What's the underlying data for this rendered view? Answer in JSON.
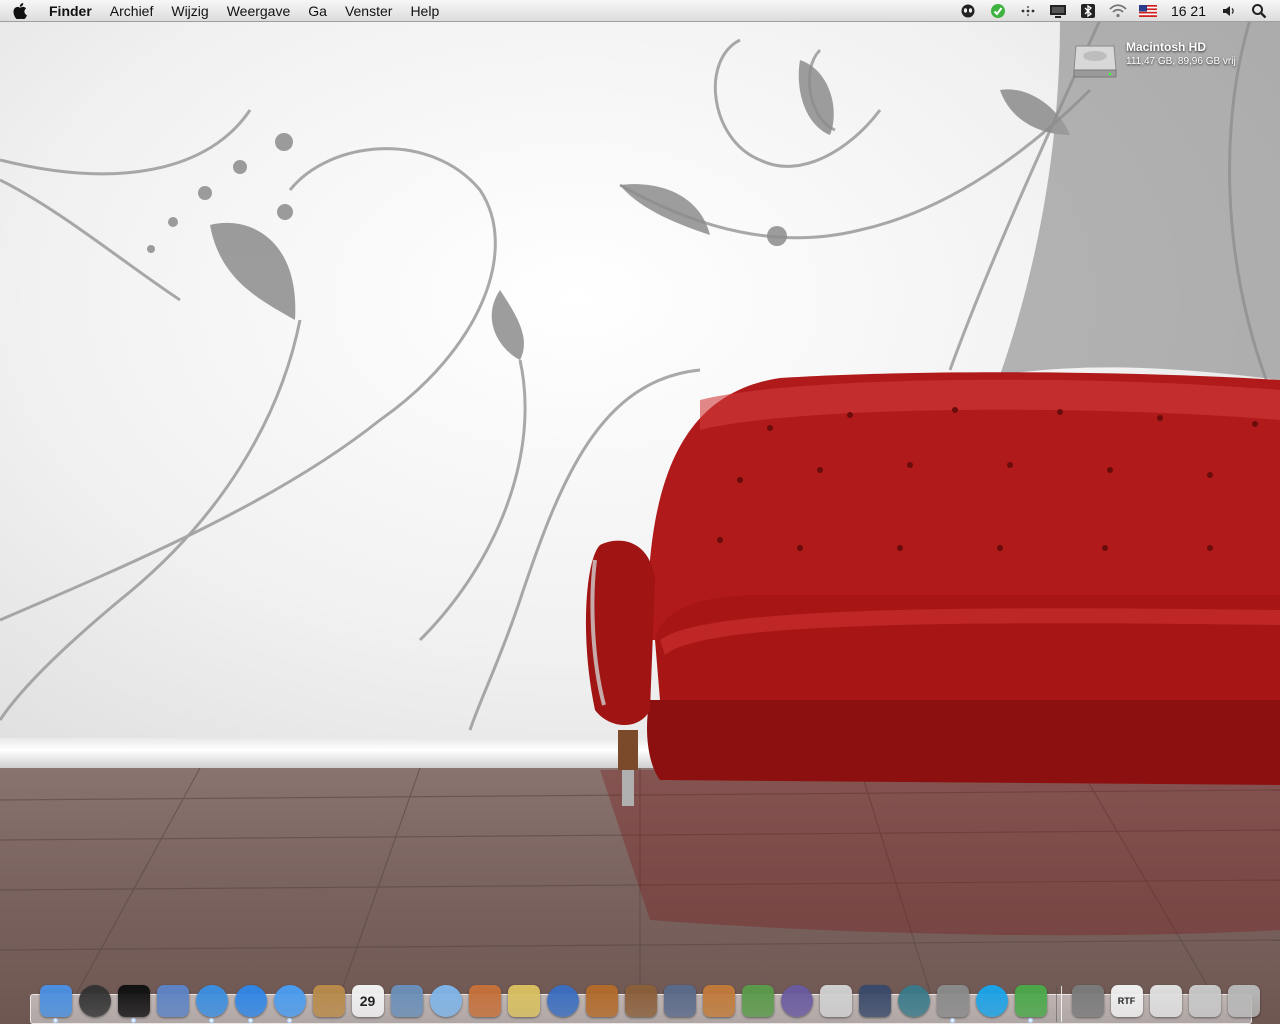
{
  "menubar": {
    "apple_icon": "apple-logo-icon",
    "items": [
      "Finder",
      "Archief",
      "Wijzig",
      "Weergave",
      "Ga",
      "Venster",
      "Help"
    ],
    "status_icons": [
      "alien-icon",
      "evernote-icon",
      "dots-icon",
      "monitor-icon",
      "bluetooth-icon",
      "wifi-icon",
      "us-flag-icon"
    ],
    "clock": "16 21",
    "volume_icon": "speaker-icon",
    "spotlight_icon": "magnifier-icon"
  },
  "desktop": {
    "disk": {
      "name": "Macintosh HD",
      "info": "111,47 GB, 89,96 GB vrij"
    }
  },
  "dock": {
    "apps": [
      {
        "icon": "finder-icon",
        "color": "#4a8fe0"
      },
      {
        "icon": "dashboard-icon",
        "color": "#333333"
      },
      {
        "icon": "terminal-icon",
        "color": "#111111"
      },
      {
        "icon": "mail-stamp-icon",
        "color": "#5d83c4"
      },
      {
        "icon": "safari-icon",
        "color": "#3b8ee0"
      },
      {
        "icon": "quicktime-icon",
        "color": "#2f86e6"
      },
      {
        "icon": "ichat-icon",
        "color": "#4a9cf0"
      },
      {
        "icon": "address-book-icon",
        "color": "#b88a4a"
      },
      {
        "icon": "ical-icon",
        "color": "#f2f2f2",
        "text": "29"
      },
      {
        "icon": "iphoto-icon",
        "color": "#6a8fb8"
      },
      {
        "icon": "itunes-icon",
        "color": "#7fb4e8"
      },
      {
        "icon": "image-capture-icon",
        "color": "#c4703a"
      },
      {
        "icon": "imovie-icon",
        "color": "#d8c060"
      },
      {
        "icon": "idvd-icon",
        "color": "#3a6ec0"
      },
      {
        "icon": "garageband-icon",
        "color": "#b26a2a"
      },
      {
        "icon": "iweb-icon",
        "color": "#8a5f3a"
      },
      {
        "icon": "script-editor-icon",
        "color": "#5a6a8a"
      },
      {
        "icon": "keynote-icon",
        "color": "#c07a3a"
      },
      {
        "icon": "numbers-icon",
        "color": "#5a9a4a"
      },
      {
        "icon": "app-store-icon",
        "color": "#6a5aa0"
      },
      {
        "icon": "pages-icon",
        "color": "#d0d0d0"
      },
      {
        "icon": "spaces-icon",
        "color": "#3a4a6a"
      },
      {
        "icon": "time-machine-icon",
        "color": "#3a7a8a"
      },
      {
        "icon": "system-preferences-icon",
        "color": "#8a8a8a"
      },
      {
        "icon": "skype-icon",
        "color": "#1aa3e8"
      },
      {
        "icon": "adium-icon",
        "color": "#4aa84a"
      }
    ],
    "docs": [
      {
        "icon": "downloads-stack-icon",
        "color": "#7a7a7a"
      },
      {
        "icon": "document-icon",
        "color": "#f0f0f0",
        "text": "RTF"
      },
      {
        "icon": "document-stack-icon",
        "color": "#e0e0e0"
      },
      {
        "icon": "preview-window-icon",
        "color": "#c8c8c8"
      },
      {
        "icon": "trash-icon",
        "color": "#b8b8b8"
      }
    ]
  }
}
